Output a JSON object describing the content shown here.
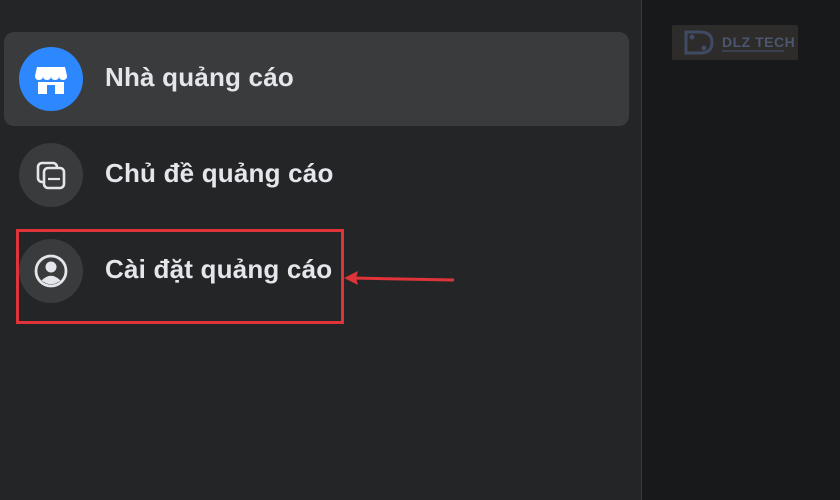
{
  "sidebar": {
    "items": [
      {
        "label": "Nhà quảng cáo",
        "icon": "storefront-icon",
        "active": true
      },
      {
        "label": "Chủ đề quảng cáo",
        "icon": "stacked-pages-icon",
        "active": false
      },
      {
        "label": "Cài đặt quảng cáo",
        "icon": "user-circle-icon",
        "active": false
      }
    ]
  },
  "annotation": {
    "highlight_color": "#e0343a"
  },
  "watermark": {
    "text": "DLZ TECH"
  },
  "colors": {
    "panel_bg": "#242526",
    "active_bg": "#3a3b3c",
    "icon_blue": "#2d88ff",
    "text": "#e4e6eb"
  }
}
